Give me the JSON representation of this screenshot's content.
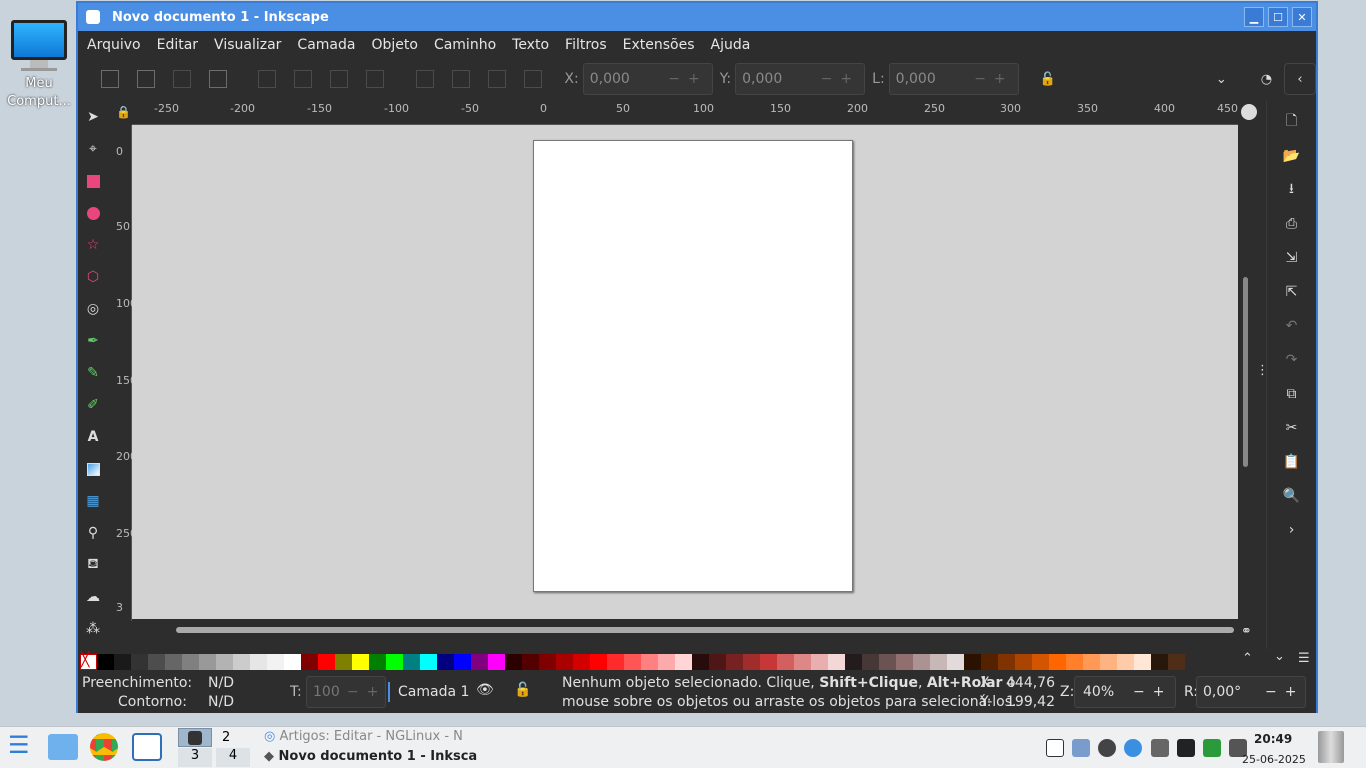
{
  "desktop": {
    "icon_label": "Meu Comput..."
  },
  "window": {
    "title": "Novo documento 1 - Inkscape"
  },
  "menu": [
    "Arquivo",
    "Editar",
    "Visualizar",
    "Camada",
    "Objeto",
    "Caminho",
    "Texto",
    "Filtros",
    "Extensões",
    "Ajuda"
  ],
  "toolbar": {
    "x_label": "X:",
    "x_value": "0,000",
    "y_label": "Y:",
    "y_value": "0,000",
    "w_label": "L:",
    "w_value": "0,000"
  },
  "ruler_h": [
    "-250",
    "-200",
    "-150",
    "-100",
    "-50",
    "0",
    "50",
    "100",
    "150",
    "200",
    "250",
    "300",
    "350",
    "400",
    "450"
  ],
  "ruler_v": [
    "0",
    "50",
    "100",
    "150",
    "200",
    "250",
    "3"
  ],
  "palette_colors": [
    "#000000",
    "#1a1a1a",
    "#333333",
    "#4d4d4d",
    "#666666",
    "#808080",
    "#999999",
    "#b3b3b3",
    "#cccccc",
    "#e6e6e6",
    "#f2f2f2",
    "#ffffff",
    "#800000",
    "#ff0000",
    "#808000",
    "#ffff00",
    "#008000",
    "#00ff00",
    "#008080",
    "#00ffff",
    "#000080",
    "#0000ff",
    "#800080",
    "#ff00ff",
    "#2b0000",
    "#550000",
    "#800000",
    "#aa0000",
    "#d40000",
    "#ff0000",
    "#ff2a2a",
    "#ff5555",
    "#ff8080",
    "#ffaaaa",
    "#ffd5d5",
    "#280b0b",
    "#501616",
    "#782121",
    "#a02c2c",
    "#c83737",
    "#d35f5f",
    "#de8787",
    "#e9afaf",
    "#f4d7d7",
    "#241c1c",
    "#483737",
    "#6c5353",
    "#916f6f",
    "#ac9393",
    "#c8b7b7",
    "#e3dbdb",
    "#2b1100",
    "#552200",
    "#803300",
    "#aa4400",
    "#d45500",
    "#ff6600",
    "#ff7f2a",
    "#ff9955",
    "#ffb380",
    "#ffccaa",
    "#ffe6d5",
    "#28170b",
    "#502d16"
  ],
  "status": {
    "fill_label": "Preenchimento:",
    "fill_value": "N/D",
    "stroke_label": "Contorno:",
    "stroke_value": "N/D",
    "opacity_label": "T:",
    "opacity_value": "100",
    "layer": "Camada 1",
    "msg_1": "Nenhum objeto selecionado. Clique,",
    "msg_b1": "Shift+Clique",
    "msg_sep": ",",
    "msg_b2": "Alt+Rolar",
    "msg_2": "o",
    "msg_3": "mouse sobre os objetos ou arraste os objetos para selecioná-los.",
    "cursor_x_label": "X:",
    "cursor_x": "444,76",
    "cursor_y_label": "Y:",
    "cursor_y": "199,42",
    "zoom_label": "Z:",
    "zoom": "40%",
    "rotate_label": "R:",
    "rotate": "0,00°"
  },
  "taskbar": {
    "workspaces": [
      "1",
      "2",
      "3",
      "4"
    ],
    "task_1": "Artigos: Editar - NGLinux - N",
    "task_2": "Novo documento 1 - Inksca",
    "time": "20:49",
    "date": "25-06-2025"
  }
}
